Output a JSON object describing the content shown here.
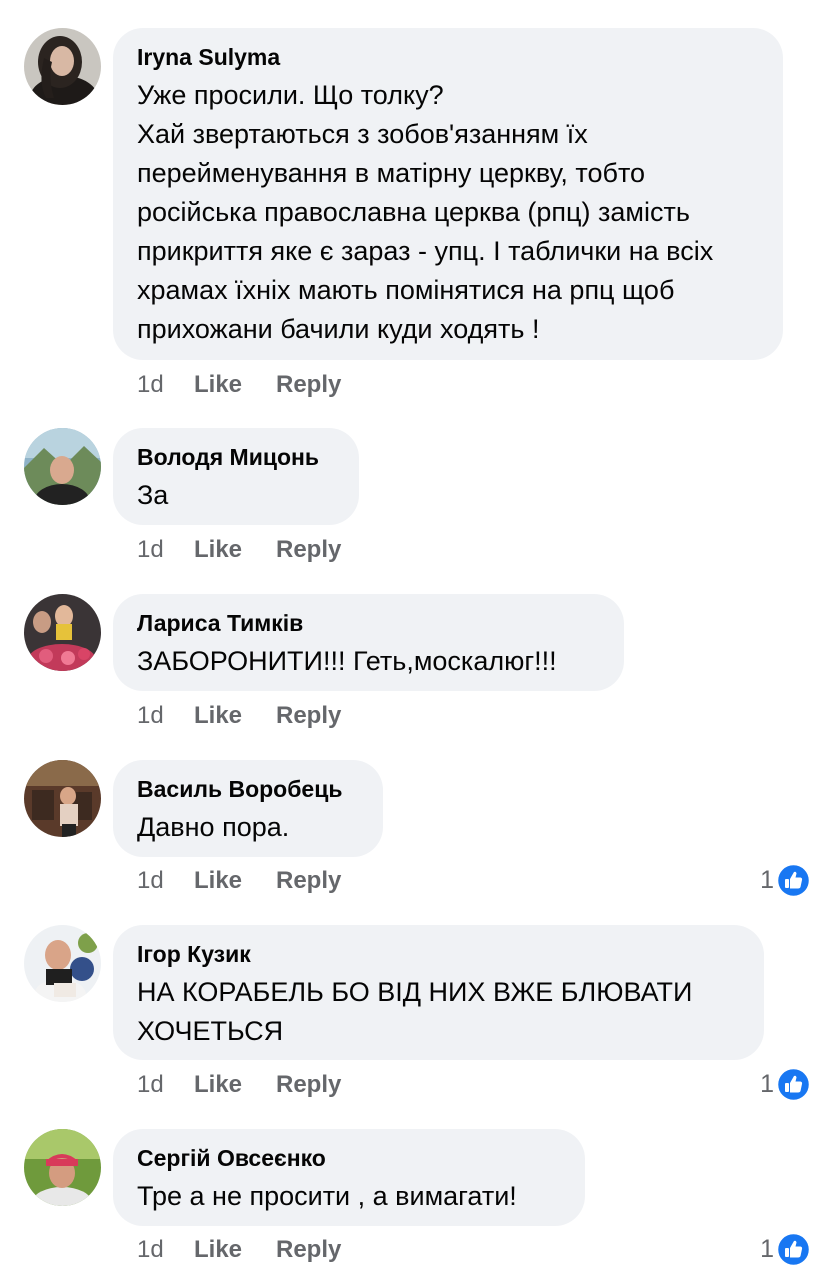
{
  "comments": [
    {
      "author": "Iryna Sulyma",
      "text": "Уже просили. Що толку?\nХай звертаються з зобов'язанням їх перейменування в матірну церкву, тобто російська православна церква (рпц) замість прикриття яке є зараз - упц. І таблички на всіх храмах їхніх мають помінятися на рпц щоб прихожани бачили куди ходять !",
      "time": "1d",
      "like": "Like",
      "reply": "Reply",
      "reactions": ""
    },
    {
      "author": "Володя Мицонь",
      "text": "За",
      "time": "1d",
      "like": "Like",
      "reply": "Reply",
      "reactions": ""
    },
    {
      "author": "Лариса Тимків",
      "text": "ЗАБОРОНИТИ!!! Геть,москалюг!!!",
      "time": "1d",
      "like": "Like",
      "reply": "Reply",
      "reactions": ""
    },
    {
      "author": "Василь Воробець",
      "text": "Давно пора.",
      "time": "1d",
      "like": "Like",
      "reply": "Reply",
      "reactions": "1"
    },
    {
      "author": "Ігор Кузик",
      "text": "НА КОРАБЕЛЬ БО ВІД НИХ ВЖЕ  БЛЮВАТИ ХОЧЕТЬСЯ",
      "time": "1d",
      "like": "Like",
      "reply": "Reply",
      "reactions": "1"
    },
    {
      "author": "Сергій Овсеєнко",
      "text": "Тре а не просити , а вимагати!",
      "time": "1d",
      "like": "Like",
      "reply": "Reply",
      "reactions": "1"
    }
  ],
  "colors": {
    "bubble": "#f0f2f5",
    "meta": "#65676b",
    "like_blue": "#1877f2"
  },
  "icons": {
    "reaction": "thumbs-up-icon"
  }
}
